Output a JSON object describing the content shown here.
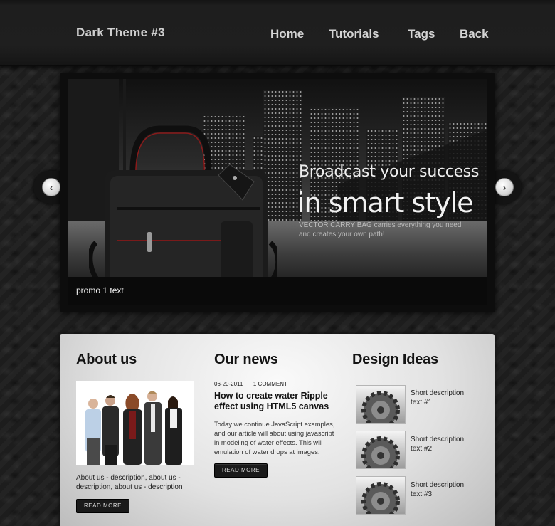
{
  "header": {
    "site_title": "Dark Theme #3",
    "nav": [
      {
        "label": "Home"
      },
      {
        "label": "Tutorials"
      },
      {
        "label": "Tags"
      },
      {
        "label": "Back"
      }
    ]
  },
  "slider": {
    "headline_1": "Broadcast your success",
    "headline_2": "in smart style",
    "subtext": "VECTOR CARRY BAG carries everything you need and creates your own path!",
    "caption": "promo 1 text",
    "prev_icon": "chevron-left-icon",
    "next_icon": "chevron-right-icon"
  },
  "about": {
    "title": "About us",
    "description": "About us - description, about us - description, about us - description",
    "button_label": "READ MORE"
  },
  "news": {
    "title": "Our news",
    "date": "06-20-2011",
    "separator": "|",
    "comments": "1 COMMENT",
    "article_title": "How to create water Ripple effect using HTML5 canvas",
    "article_body": "Today we continue JavaScript examples, and our article will about using javascript in modeling of water effects. This will emulation of water drops at images.",
    "button_label": "READ MORE"
  },
  "ideas": {
    "title": "Design Ideas",
    "items": [
      {
        "text": "Short description text #1",
        "icon": "gear-icon"
      },
      {
        "text": "Short description text #2",
        "icon": "gear-icon"
      },
      {
        "text": "Short description text #3",
        "icon": "gear-icon"
      }
    ]
  },
  "colors": {
    "background": "#232323",
    "header": "#1e1e1e",
    "panel": "#e2e2e2",
    "button": "#1a1a1a"
  }
}
